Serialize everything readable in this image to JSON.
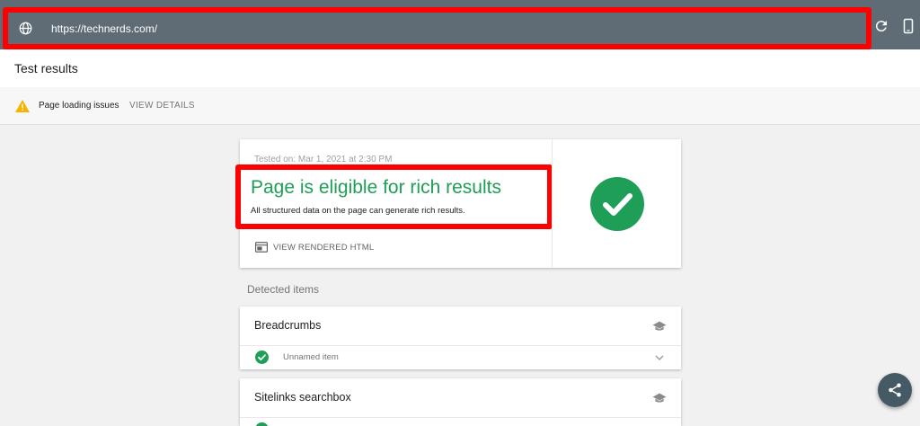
{
  "toolbar": {
    "url": "https://technerds.com/",
    "icons": [
      "globe-icon",
      "refresh-icon",
      "mobile-icon"
    ],
    "bar_color": "#5f6c75"
  },
  "results": {
    "title": "Test results"
  },
  "issues": {
    "text": "Page loading issues",
    "action": "VIEW DETAILS"
  },
  "summary": {
    "tested_on": "Tested on: Mar 1, 2021 at 2:30 PM",
    "status_title": "Page is eligible for rich results",
    "status_subtitle": "All structured data on the page can generate rich results.",
    "view_html": "VIEW RENDERED HTML",
    "status_color": "#1e9e57"
  },
  "detected": {
    "label": "Detected items",
    "items": [
      {
        "title": "Breadcrumbs",
        "row_text": "Unnamed item"
      },
      {
        "title": "Sitelinks searchbox"
      }
    ]
  },
  "highlight_color": "#ff0000"
}
